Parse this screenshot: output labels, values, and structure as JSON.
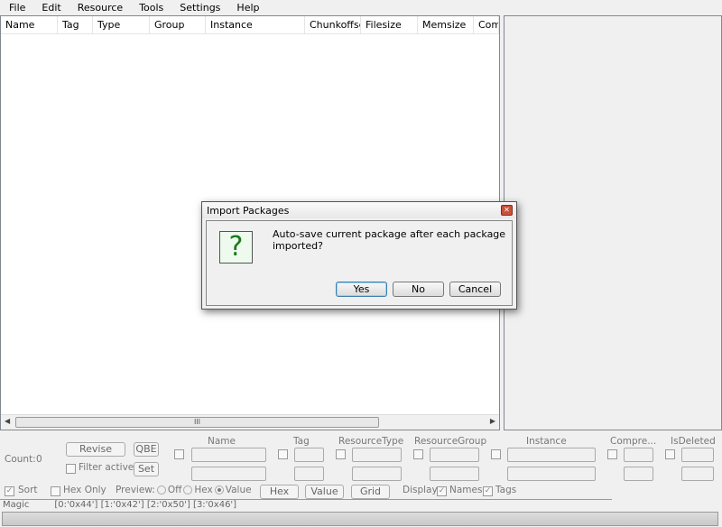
{
  "menu": [
    "File",
    "Edit",
    "Resource",
    "Tools",
    "Settings",
    "Help"
  ],
  "columns": [
    "Name",
    "Tag",
    "Type",
    "Group",
    "Instance",
    "Chunkoffset",
    "Filesize",
    "Memsize",
    "Com"
  ],
  "dialog": {
    "title": "Import Packages",
    "message": "Auto-save current package after each package imported?",
    "icon": "?",
    "yes": "Yes",
    "no": "No",
    "cancel": "Cancel"
  },
  "filter": {
    "count_label": "Count:",
    "count": "0",
    "revise": "Revise",
    "qbe": "QBE",
    "set": "Set",
    "filter_active": "Filter active",
    "fields": [
      "Name",
      "Tag",
      "ResourceType",
      "ResourceGroup",
      "Instance",
      "Compre...",
      "IsDeleted"
    ]
  },
  "options": {
    "sort": "Sort",
    "hex_only": "Hex Only",
    "preview": "Preview:",
    "off": "Off",
    "hex": "Hex",
    "value": "Value",
    "hex_btn": "Hex",
    "value_btn": "Value",
    "grid_btn": "Grid",
    "display": "Display:",
    "names": "Names",
    "tags": "Tags"
  },
  "magic": {
    "label": "Magic",
    "value": "[0:'0x44'] [1:'0x42'] [2:'0x50'] [3:'0x46']"
  },
  "scroll_thumb": "III"
}
